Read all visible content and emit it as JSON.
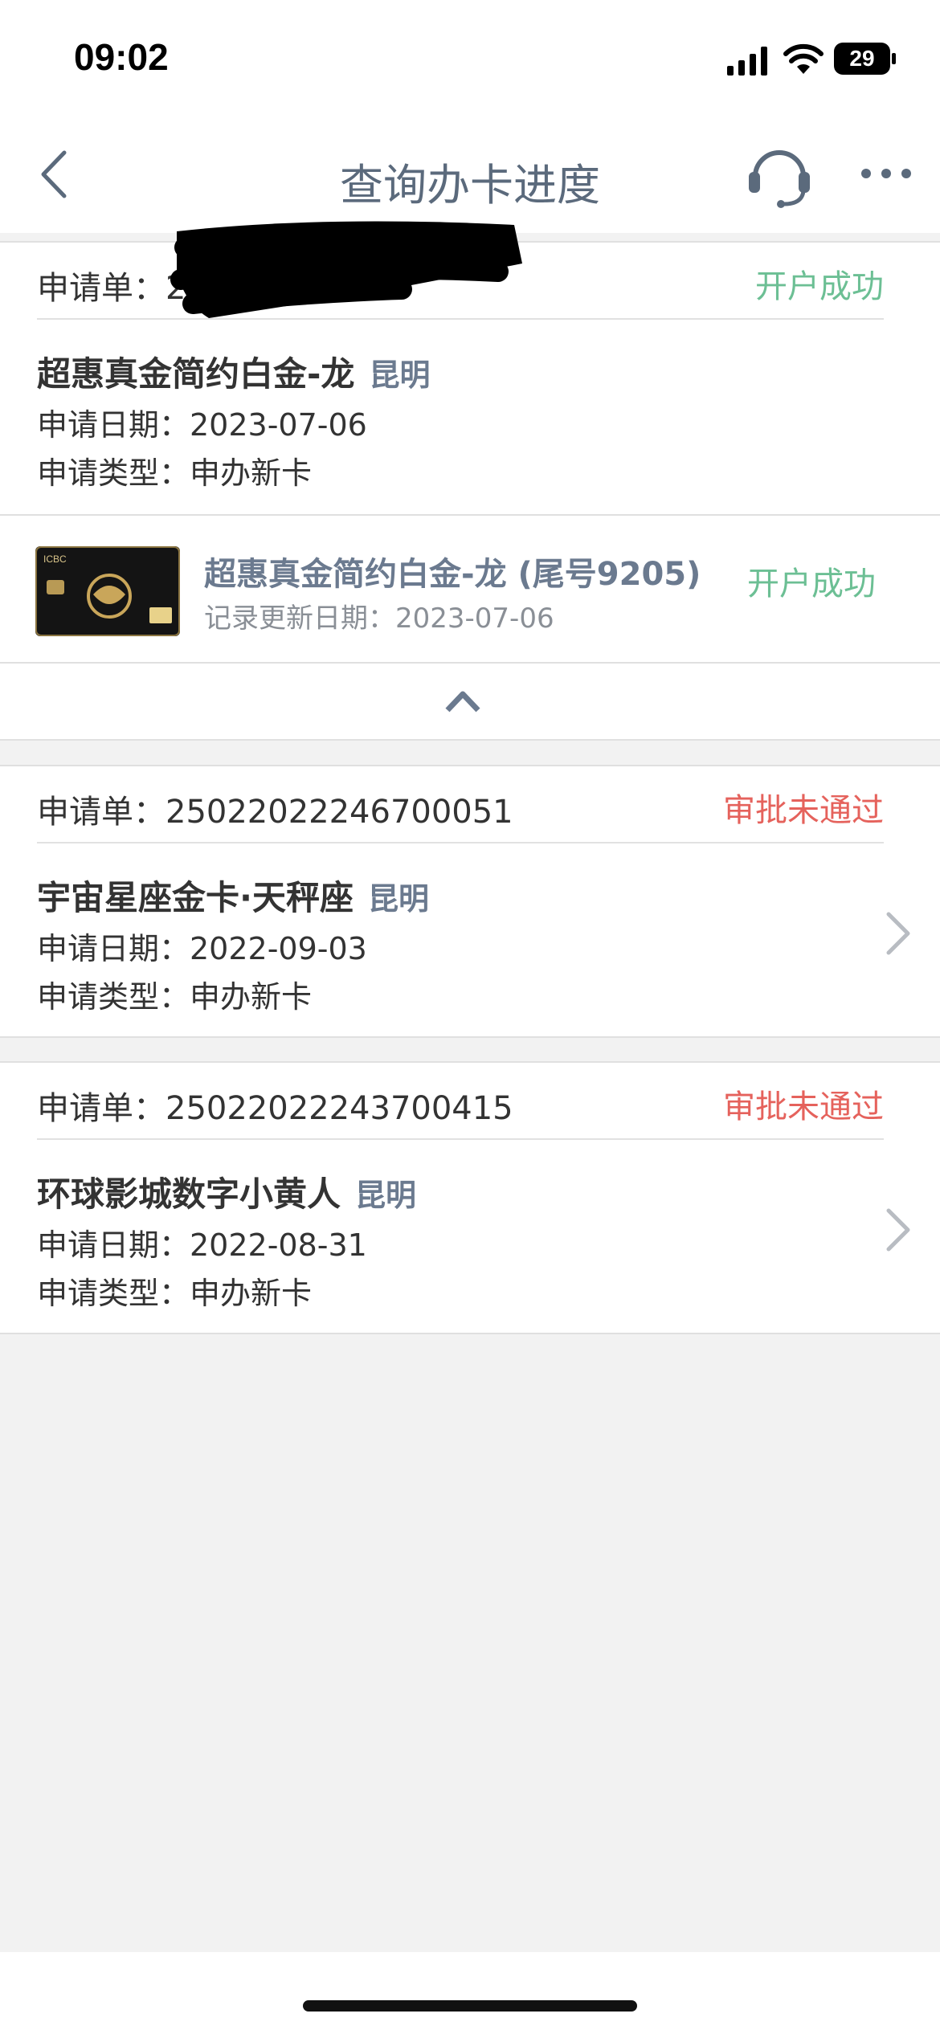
{
  "status_bar": {
    "time": "09:02",
    "battery": "29"
  },
  "nav": {
    "title": "查询办卡进度"
  },
  "applications": [
    {
      "request_label": "申请单：2",
      "status": "开户成功",
      "card_name": "超惠真金简约白金-龙",
      "city": "昆明",
      "date_line": "申请日期：2023-07-06",
      "type_line": "申请类型：申办新卡"
    },
    {
      "request_label": "申请单：2502202224670​0051",
      "status": "审批未通过",
      "card_name": "宇宙星座金卡·天秤座",
      "city": "昆明",
      "date_line": "申请日期：2022-09-03",
      "type_line": "申请类型：申办新卡"
    },
    {
      "request_label": "申请单：2502202224370​0415",
      "status": "审批未通过",
      "card_name": "环球影城数字小黄人",
      "city": "昆明",
      "date_line": "申请日期：2022-08-31",
      "type_line": "申请类型：申办新卡"
    }
  ],
  "product": {
    "name": "超惠真金简约白金-龙 (尾号9205)",
    "updated": "记录更新日期：2023-07-06",
    "status": "开户成功",
    "thumb_text": "ICBC"
  },
  "colors": {
    "success": "#6cbf94",
    "fail": "#e5625c",
    "title": "#5b6a7c"
  }
}
